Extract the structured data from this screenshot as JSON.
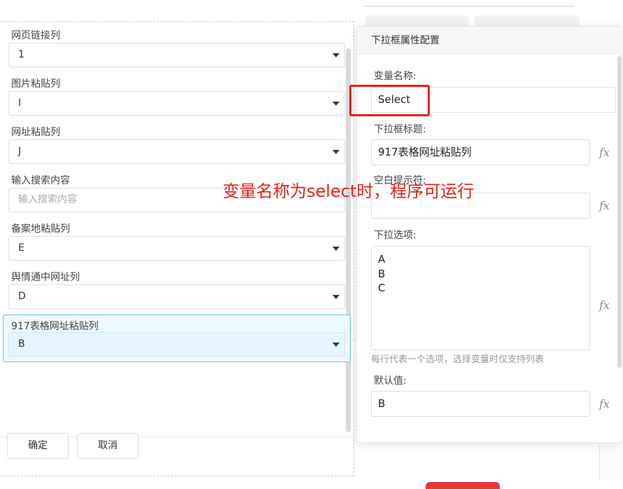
{
  "form": {
    "fields": [
      {
        "label": "网页链接列",
        "value": "1",
        "type": "select"
      },
      {
        "label": "图片粘贴列",
        "value": "I",
        "type": "select"
      },
      {
        "label": "网址粘贴列",
        "value": "J",
        "type": "select"
      },
      {
        "label": "输入搜索内容",
        "placeholder": "输入搜索内容",
        "type": "input"
      },
      {
        "label": "备案地粘贴列",
        "value": "E",
        "type": "select"
      },
      {
        "label": "舆情通中网址列",
        "value": "D",
        "type": "select"
      },
      {
        "label": "917表格网址粘贴列",
        "value": "B",
        "type": "select"
      }
    ],
    "confirm_label": "确定",
    "cancel_label": "取消"
  },
  "popover": {
    "title": "下拉框属性配置",
    "var_name_label": "变量名称:",
    "var_name_value": "Select",
    "dropdown_title_label": "下拉框标题:",
    "dropdown_title_value": "917表格网址粘贴列",
    "placeholder_label": "空白提示符:",
    "placeholder_value": "",
    "options_label": "下拉选项:",
    "options_lines": [
      "A",
      "B",
      "C"
    ],
    "options_hint": "每行代表一个选项，选择变量时仅支持列表",
    "default_label": "默认值:",
    "default_value": "B",
    "fx": "fx"
  },
  "annotation": {
    "text": "变量名称为select时，程序可运行",
    "color": "#e2231a"
  },
  "colors": {
    "selected_border": "#5cc7c9",
    "selected_bg": "#eef9fd"
  }
}
